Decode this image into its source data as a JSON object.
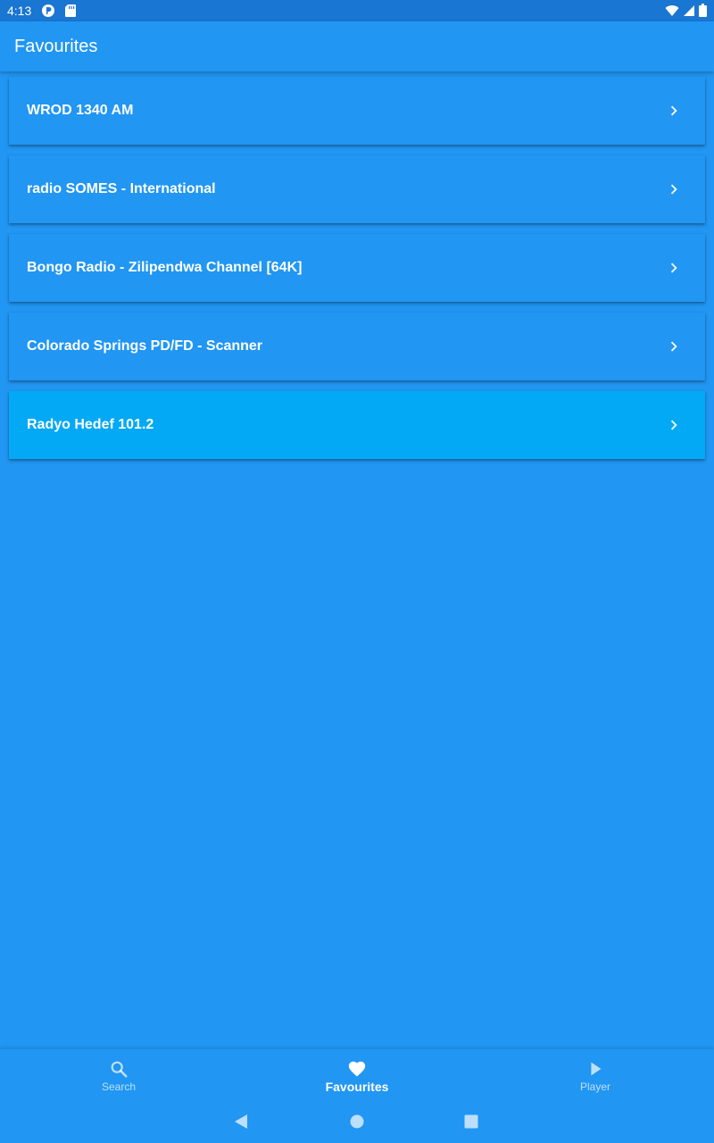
{
  "status_bar": {
    "time": "4:13",
    "left_icons": [
      "notification-app-icon",
      "sd-card-icon"
    ],
    "right_icons": [
      "wifi-icon",
      "cell-signal-icon",
      "battery-icon"
    ]
  },
  "app_bar": {
    "title": "Favourites"
  },
  "favourites": [
    {
      "label": "WROD 1340 AM"
    },
    {
      "label": "radio SOMES - International"
    },
    {
      "label": "Bongo Radio - Zilipendwa Channel [64K]"
    },
    {
      "label": "Colorado Springs PD/FD - Scanner"
    },
    {
      "label": "Radyo Hedef 101.2"
    }
  ],
  "bottom_nav": {
    "items": [
      {
        "label": "Search",
        "icon": "search-icon",
        "active": false
      },
      {
        "label": "Favourites",
        "icon": "heart-icon",
        "active": true
      },
      {
        "label": "Player",
        "icon": "play-icon",
        "active": false
      }
    ]
  },
  "system_nav": {
    "buttons": [
      "back-icon",
      "home-icon",
      "recents-icon"
    ]
  },
  "colors": {
    "background": "#2196f3",
    "status_bar": "#1976d2",
    "highlighted_item": "#03a9f4",
    "text": "#ffffff"
  }
}
